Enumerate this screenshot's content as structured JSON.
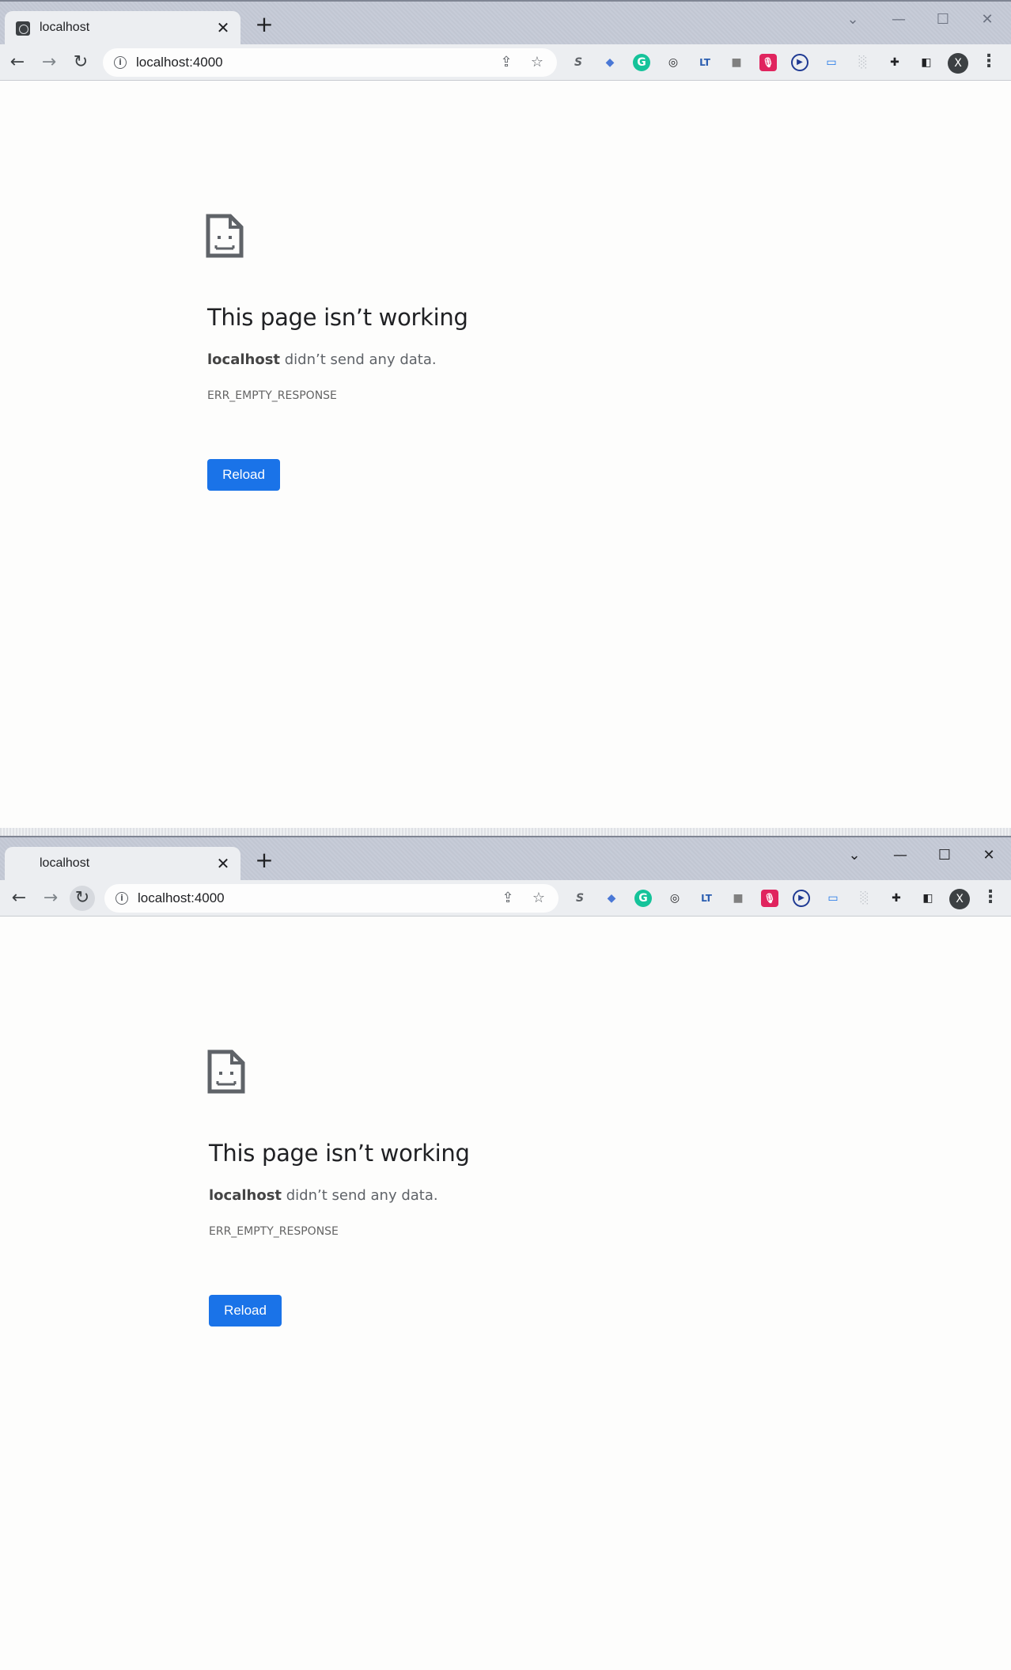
{
  "frames": [
    {
      "tab": {
        "title": "localhost"
      },
      "omnibox": {
        "url": "localhost:4000"
      },
      "error": {
        "heading": "This page isn’t working",
        "host": "localhost",
        "message_rest": " didn’t send any data.",
        "code": "ERR_EMPTY_RESPONSE",
        "reload_label": "Reload"
      },
      "profile_initial": "X"
    },
    {
      "tab": {
        "title": "localhost"
      },
      "omnibox": {
        "url": "localhost:4000"
      },
      "error": {
        "heading": "This page isn’t working",
        "host": "localhost",
        "message_rest": " didn’t send any data.",
        "code": "ERR_EMPTY_RESPONSE",
        "reload_label": "Reload"
      },
      "profile_initial": "X"
    }
  ],
  "icons": {
    "back": "←",
    "forward": "→",
    "reload": "↻",
    "close": "✕",
    "new_tab": "+",
    "minimize": "—",
    "maximize": "☐",
    "tab_search": "⌄",
    "share": "⇪",
    "star": "☆",
    "extensions": [
      "S",
      "◆",
      "G",
      "◎",
      "LT",
      "■",
      "🎙",
      "▶",
      "▭",
      "░",
      "✚",
      "◧"
    ],
    "menu": "⋮"
  },
  "colors": {
    "accent": "#1a73e8",
    "titlebar": "#c3c8d4",
    "toolbar": "#eceef1"
  }
}
